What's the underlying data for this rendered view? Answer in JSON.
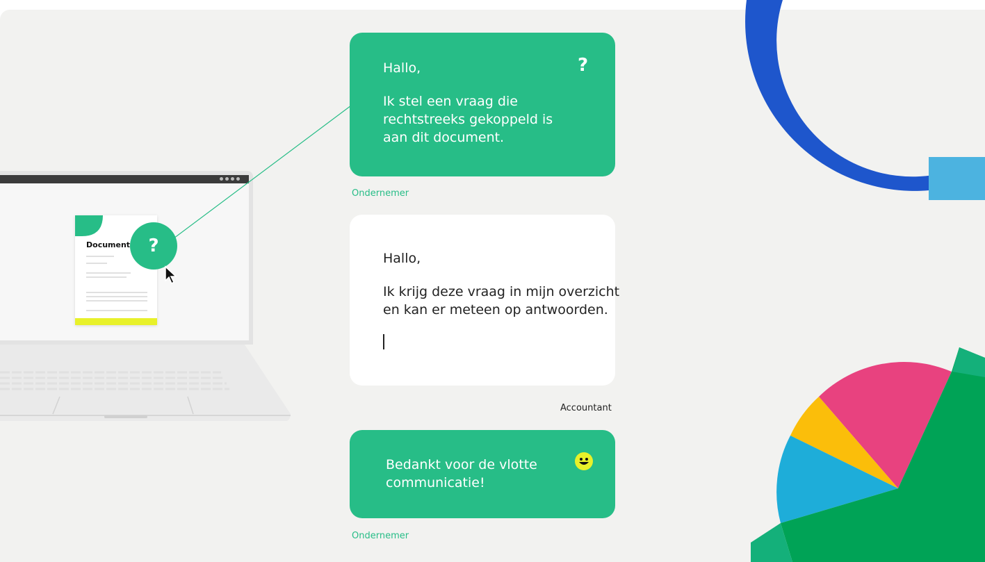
{
  "colors": {
    "brand_green": "#27bd87",
    "ring_blue": "#1e56cc",
    "ring_light_blue": "#4cb3e0",
    "pie_pink": "#e8427f",
    "pie_yellow": "#fbbe0a",
    "pie_cyan": "#1eadd9",
    "pie_green": "#00a356",
    "highlight_yellow": "#e8f12a"
  },
  "laptop": {
    "document_title": "Document",
    "question_icon": "?"
  },
  "chat": {
    "messages": [
      {
        "lines": [
          "Hallo,",
          "",
          "Ik stel een vraag die",
          "rechtstreeks gekoppeld is",
          "aan dit document."
        ],
        "icon": "?",
        "sender": "Ondernemer"
      },
      {
        "lines": [
          "Hallo,",
          "",
          "Ik krijg deze vraag  in mijn overzicht",
          "en kan er meteen op antwoorden."
        ],
        "sender": "Accountant"
      },
      {
        "lines": [
          "Bedankt voor de vlotte",
          "communicatie!"
        ],
        "icon": "smiley-icon",
        "sender": "Ondernemer"
      }
    ]
  }
}
